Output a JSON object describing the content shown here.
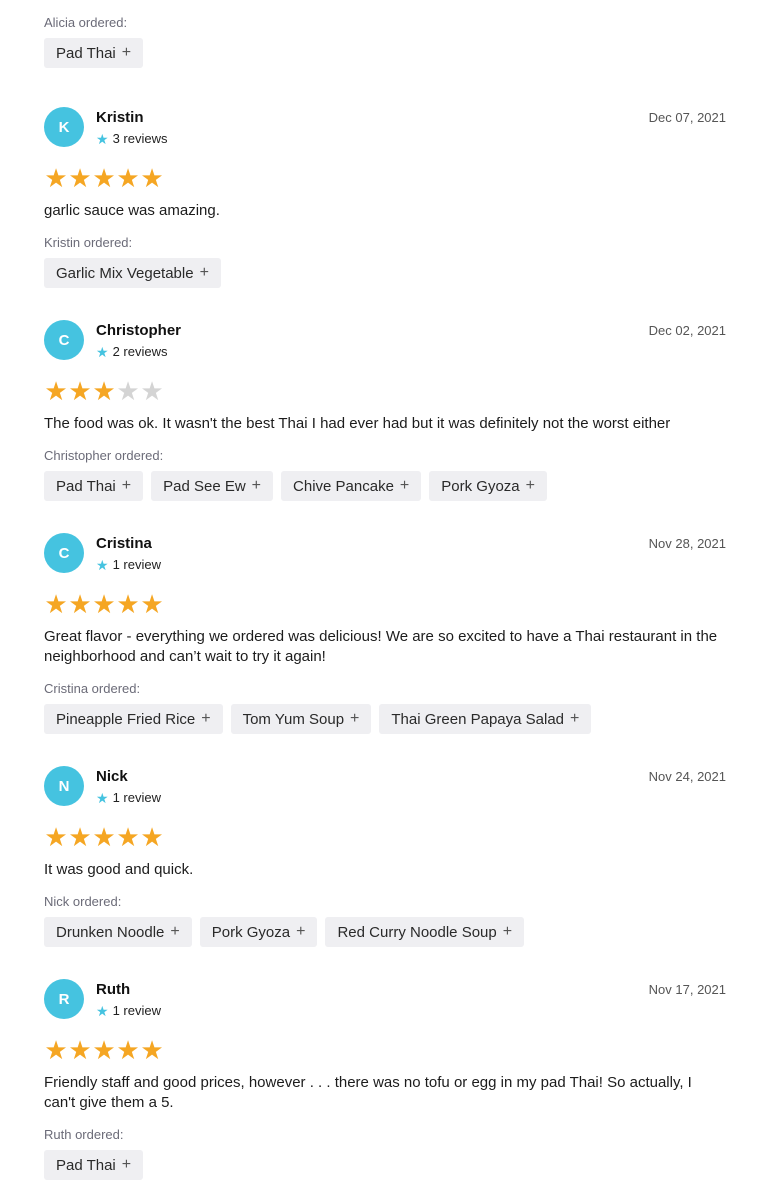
{
  "first": {
    "ordered_label": "Alicia ordered:",
    "items": [
      "Pad Thai"
    ]
  },
  "reviews": [
    {
      "initial": "K",
      "name": "Kristin",
      "reviews_count": "3 reviews",
      "date": "Dec 07, 2021",
      "rating": 5,
      "text": "garlic sauce was amazing.",
      "ordered_label": "Kristin ordered:",
      "items": [
        "Garlic Mix Vegetable"
      ]
    },
    {
      "initial": "C",
      "name": "Christopher",
      "reviews_count": "2 reviews",
      "date": "Dec 02, 2021",
      "rating": 3,
      "text": "The food was ok. It wasn't the best Thai I had ever had but it was definitely not the worst either",
      "ordered_label": "Christopher ordered:",
      "items": [
        "Pad Thai",
        "Pad See Ew",
        "Chive Pancake",
        "Pork Gyoza"
      ]
    },
    {
      "initial": "C",
      "name": "Cristina",
      "reviews_count": "1 review",
      "date": "Nov 28, 2021",
      "rating": 5,
      "text": "Great flavor - everything we ordered was delicious! We are so excited to have a Thai restaurant in the neighborhood and can’t wait to try it again!",
      "ordered_label": "Cristina ordered:",
      "items": [
        "Pineapple Fried Rice",
        "Tom Yum Soup",
        "Thai Green Papaya Salad"
      ]
    },
    {
      "initial": "N",
      "name": "Nick",
      "reviews_count": "1 review",
      "date": "Nov 24, 2021",
      "rating": 5,
      "text": "It was good and quick.",
      "ordered_label": "Nick ordered:",
      "items": [
        "Drunken Noodle",
        "Pork Gyoza",
        "Red Curry Noodle Soup"
      ]
    },
    {
      "initial": "R",
      "name": "Ruth",
      "reviews_count": "1 review",
      "date": "Nov 17, 2021",
      "rating": 5,
      "text": "Friendly staff and good prices, however . . . there was no tofu or egg in my pad Thai! So actually, I can't give them a 5.",
      "ordered_label": "Ruth ordered:",
      "items": [
        "Pad Thai"
      ]
    }
  ],
  "colors": {
    "avatar": "#45c3e0",
    "star_filled": "#f5a623",
    "star_empty": "#d4d4d4",
    "chip_bg": "#efeff2"
  },
  "icons": {
    "review_count": "star-icon",
    "add_item": "plus-icon"
  }
}
